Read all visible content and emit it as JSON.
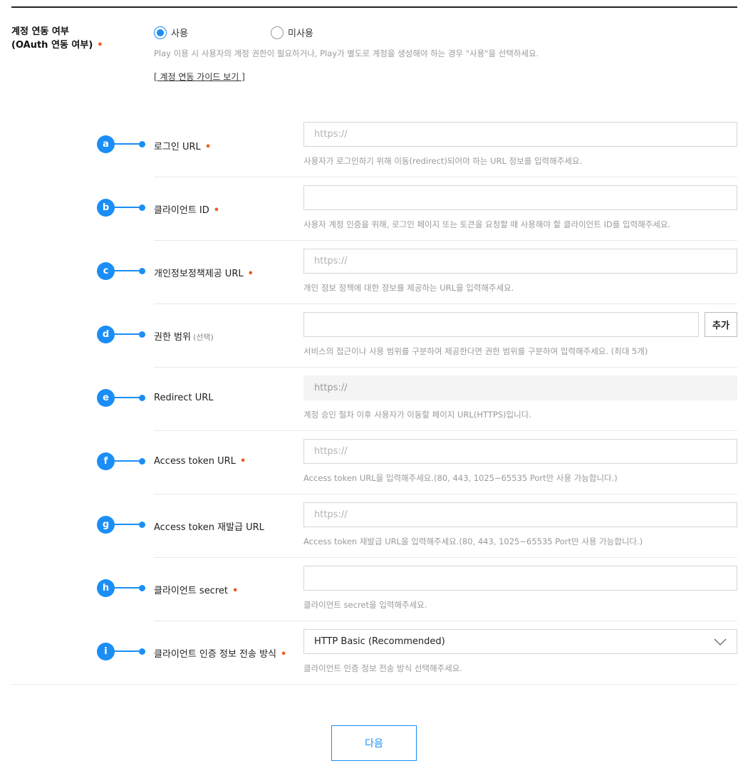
{
  "oauth": {
    "label_line1": "계정 연동 여부",
    "label_line2": "(OAuth 연동 여부)",
    "required_mark": "•",
    "option_use": "사용",
    "option_unused": "미사용",
    "selected": "사용",
    "help": "Play 이용 시 사용자의 계정 권한이 필요하거나, Play가 별도로 계정을 생성해야 하는 경우 \"사용\"을 선택하세요.",
    "guide_link": "[ 계정 연동 가이드 보기 ]"
  },
  "fields": [
    {
      "marker": "a",
      "label": "로그인 URL",
      "required": "•",
      "placeholder": "https://",
      "value": "",
      "help": "사용자가 로그인하기 위해 이동(redirect)되어야 하는 URL 정보를 입력해주세요."
    },
    {
      "marker": "b",
      "label": "클라이언트 ID",
      "required": "•",
      "placeholder": "",
      "value": "",
      "help": "사용자 계정 인증을 위해, 로그인 페이지 또는 토큰을 요청할 때 사용해야 할 클라이언트 ID를 입력해주세요."
    },
    {
      "marker": "c",
      "label": "개인정보정책제공 URL",
      "required": "•",
      "placeholder": "https://",
      "value": "",
      "help": "개인 정보 정책에 대한 정보를 제공하는 URL을 입력해주세요."
    },
    {
      "marker": "d",
      "label": "권한 범위",
      "optional": "(선택)",
      "placeholder": "",
      "value": "",
      "button": "추가",
      "help": "서비스의 접근이나 사용 범위를 구분하여 제공한다면 권한 범위를 구분하여 입력해주세요. (최대 5개)"
    },
    {
      "marker": "e",
      "label": "Redirect URL",
      "value": "https://",
      "help": "계정 승인 절차 이후 사용자가 이동할 페이지 URL(HTTPS)입니다."
    },
    {
      "marker": "f",
      "label": "Access token URL",
      "required": "•",
      "placeholder": "https://",
      "value": "",
      "help": "Access token URL을 입력해주세요.(80, 443, 1025~65535 Port만 사용 가능합니다.)"
    },
    {
      "marker": "g",
      "label": "Access token 재발급 URL",
      "placeholder": "https://",
      "value": "",
      "help": "Access token 재발급 URL을 입력해주세요.(80, 443, 1025~65535 Port만 사용 가능합니다.)"
    },
    {
      "marker": "h",
      "label": "클라이언트 secret",
      "required": "•",
      "placeholder": "",
      "value": "",
      "help": "클라이언트 secret을 입력해주세요."
    },
    {
      "marker": "i",
      "label": "클라이언트 인증 정보 전송 방식",
      "required": "•",
      "selected": "HTTP Basic (Recommended)",
      "help": "클라이언트 인증 정보 전송 방식 선택해주세요."
    }
  ],
  "next_button": "다음",
  "colors": {
    "accent": "#1a8ef5",
    "required": "#f15a22",
    "help_text": "#9a9a9a"
  },
  "icons": {
    "select_arrow": "chevron-down-icon"
  }
}
